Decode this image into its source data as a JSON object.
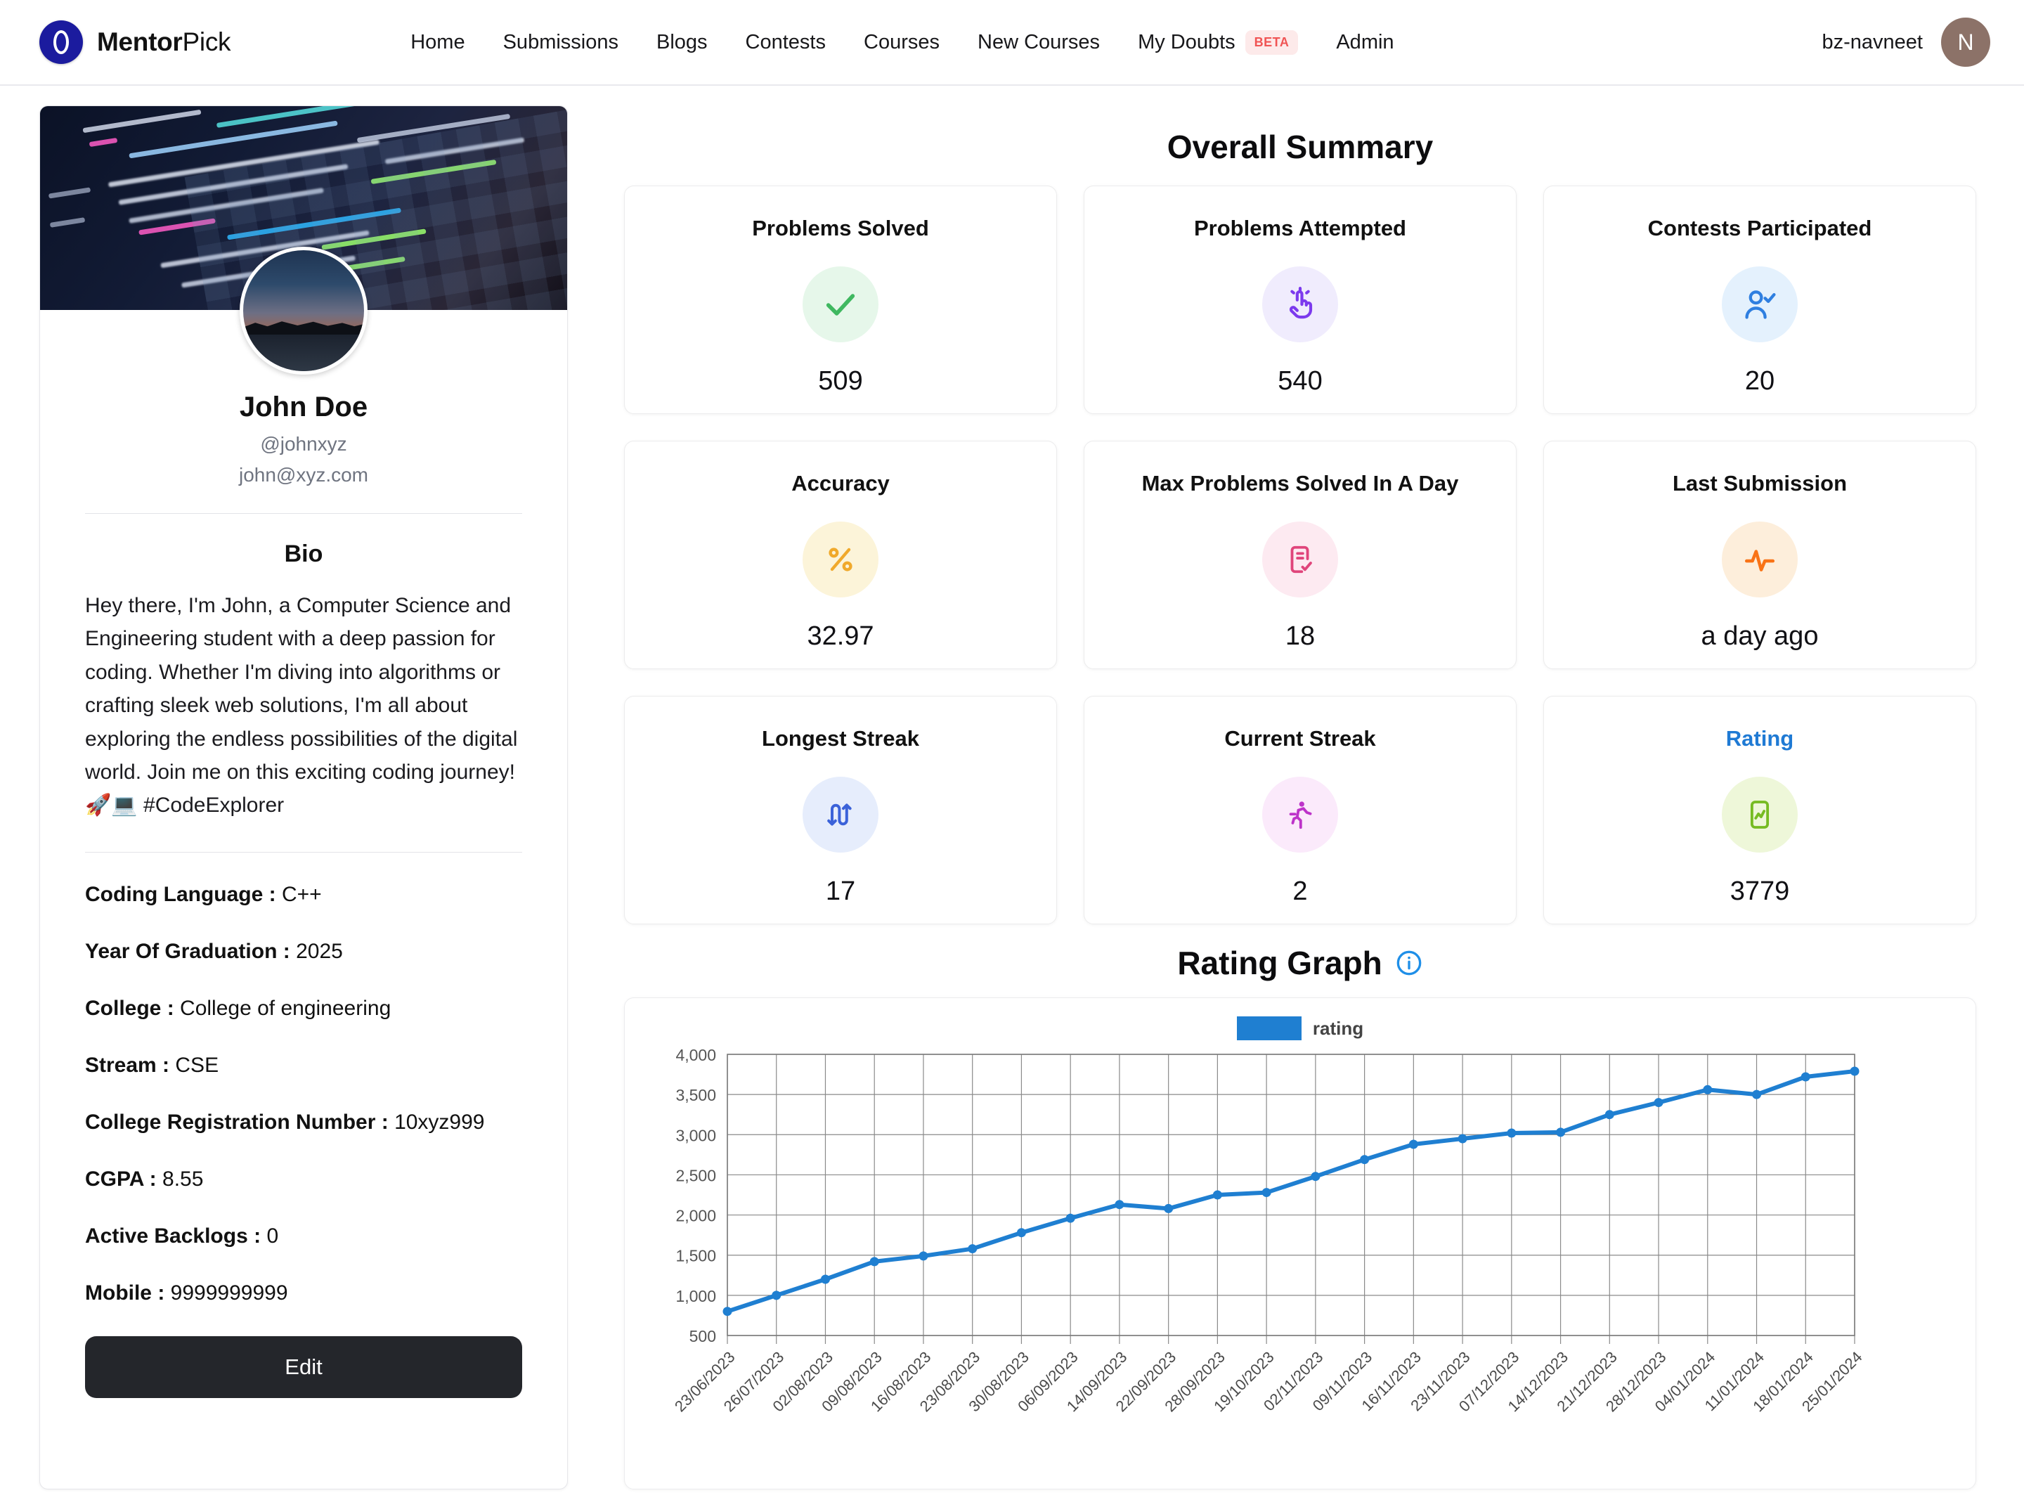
{
  "navbar": {
    "brand_bold": "Mentor",
    "brand_normal": "Pick",
    "logo_icon": "mentorpick-logo-icon",
    "links": [
      {
        "label": "Home"
      },
      {
        "label": "Submissions"
      },
      {
        "label": "Blogs"
      },
      {
        "label": "Contests"
      },
      {
        "label": "Courses"
      },
      {
        "label": "New Courses"
      },
      {
        "label": "My Doubts",
        "badge": "BETA"
      },
      {
        "label": "Admin"
      }
    ],
    "username": "bz-navneet",
    "avatar_initial": "N"
  },
  "profile": {
    "name": "John Doe",
    "handle": "@johnxyz",
    "email": "john@xyz.com",
    "bio_title": "Bio",
    "bio_text": "Hey there, I'm John, a Computer Science and Engineering student with a deep passion for coding. Whether I'm diving into algorithms or crafting sleek web solutions, I'm all about exploring the endless possibilities of the digital world. Join me on this exciting coding journey! 🚀💻 #CodeExplorer",
    "fields": [
      {
        "key": "Coding Language :",
        "value": "C++"
      },
      {
        "key": "Year Of Graduation :",
        "value": "2025"
      },
      {
        "key": "College :",
        "value": "College of engineering"
      },
      {
        "key": "Stream :",
        "value": "CSE"
      },
      {
        "key": "College Registration Number :",
        "value": "10xyz999"
      },
      {
        "key": "CGPA :",
        "value": "8.55"
      },
      {
        "key": "Active Backlogs :",
        "value": "0"
      },
      {
        "key": "Mobile :",
        "value": "9999999999"
      }
    ],
    "edit_label": "Edit"
  },
  "summary": {
    "title": "Overall Summary",
    "cards": [
      {
        "label": "Problems Solved",
        "value": "509",
        "icon": "check-icon",
        "icon_bg": "#e6f7ea",
        "icon_color": "#3fb860",
        "is_link": false
      },
      {
        "label": "Problems Attempted",
        "value": "540",
        "icon": "tap-finger-icon",
        "icon_bg": "#f0ecfd",
        "icon_color": "#7c3aed",
        "is_link": false
      },
      {
        "label": "Contests Participated",
        "value": "20",
        "icon": "user-check-icon",
        "icon_bg": "#e4f1fd",
        "icon_color": "#2f7fe0",
        "is_link": false
      },
      {
        "label": "Accuracy",
        "value": "32.97",
        "icon": "percent-icon",
        "icon_bg": "#fcf4d9",
        "icon_color": "#f0a92b",
        "is_link": false
      },
      {
        "label": "Max Problems Solved In A Day",
        "value": "18",
        "icon": "list-check-icon",
        "icon_bg": "#fdeaf1",
        "icon_color": "#e0457b",
        "is_link": false
      },
      {
        "label": "Last Submission",
        "value": "a day ago",
        "icon": "activity-pulse-icon",
        "icon_bg": "#fdeedb",
        "icon_color": "#f97316",
        "is_link": false
      },
      {
        "label": "Longest Streak",
        "value": "17",
        "icon": "streak-arrows-icon",
        "icon_bg": "#e6edfc",
        "icon_color": "#3b62d9",
        "is_link": false
      },
      {
        "label": "Current Streak",
        "value": "2",
        "icon": "running-person-icon",
        "icon_bg": "#fbeafb",
        "icon_color": "#bd33c9",
        "is_link": false
      },
      {
        "label": "Rating",
        "value": "3779",
        "icon": "rating-chart-icon",
        "icon_bg": "#eef7d9",
        "icon_color": "#76bb22",
        "is_link": true
      }
    ]
  },
  "rating_graph": {
    "title": "Rating Graph",
    "info_icon": "info-circle-icon"
  },
  "chart_data": {
    "type": "line",
    "title": "Rating Graph",
    "legend": [
      "rating"
    ],
    "legend_position": "top-center",
    "series_color": "#1f7fd1",
    "grid": true,
    "xlabel": "",
    "ylabel": "",
    "ylim": [
      500,
      4000
    ],
    "yticks": [
      "4,000",
      "3,500",
      "3,000",
      "2,500",
      "2,000",
      "1,500",
      "1,000",
      "500"
    ],
    "categories": [
      "23/06/2023",
      "26/07/2023",
      "02/08/2023",
      "09/08/2023",
      "16/08/2023",
      "23/08/2023",
      "30/08/2023",
      "06/09/2023",
      "14/09/2023",
      "22/09/2023",
      "28/09/2023",
      "19/10/2023",
      "02/11/2023",
      "09/11/2023",
      "16/11/2023",
      "23/11/2023",
      "07/12/2023",
      "14/12/2023",
      "21/12/2023",
      "28/12/2023",
      "04/01/2024",
      "11/01/2024",
      "18/01/2024",
      "25/01/2024"
    ],
    "series": [
      {
        "name": "rating",
        "values": [
          800,
          1000,
          1200,
          1420,
          1490,
          1580,
          1780,
          1960,
          2130,
          2080,
          2250,
          2280,
          2480,
          2690,
          2880,
          2950,
          3020,
          3030,
          3250,
          3400,
          3560,
          3500,
          3720,
          3790
        ]
      }
    ]
  }
}
